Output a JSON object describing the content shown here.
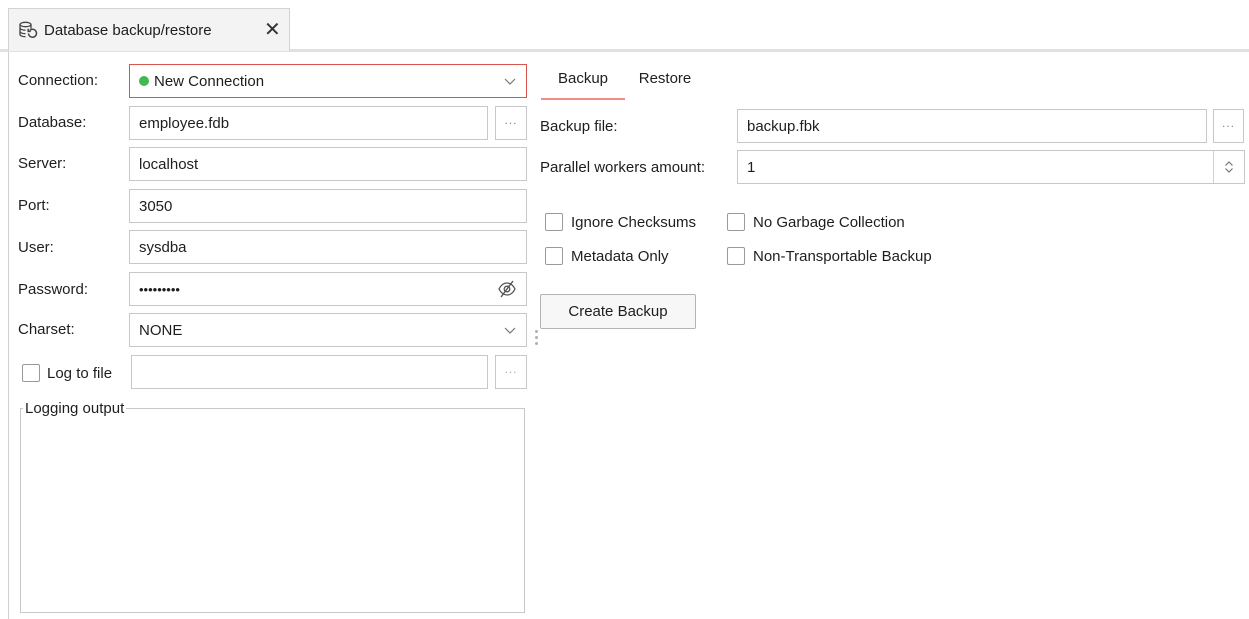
{
  "tab": {
    "title": "Database backup/restore",
    "icon": "database-sync-icon",
    "close_icon": "close-icon"
  },
  "connection": {
    "connection_label": "Connection:",
    "connection_value": "New Connection",
    "connection_status_color": "#3fb950",
    "database_label": "Database:",
    "database_value": "employee.fdb",
    "server_label": "Server:",
    "server_value": "localhost",
    "port_label": "Port:",
    "port_value": "3050",
    "user_label": "User:",
    "user_value": "sysdba",
    "password_label": "Password:",
    "password_value": "•••••••••",
    "charset_label": "Charset:",
    "charset_value": "NONE",
    "log_to_file_label": "Log to file",
    "log_to_file_checked": false,
    "log_file_value": "",
    "browse_label": "...",
    "logging_output_label": "Logging output"
  },
  "tabs": [
    {
      "label": "Backup",
      "active": true
    },
    {
      "label": "Restore",
      "active": false
    }
  ],
  "backup": {
    "backup_file_label": "Backup file:",
    "backup_file_value": "backup.fbk",
    "parallel_label": "Parallel workers amount:",
    "parallel_value": "1",
    "options": [
      {
        "label": "Ignore Checksums",
        "checked": false
      },
      {
        "label": "No Garbage Collection",
        "checked": false
      },
      {
        "label": "Metadata Only",
        "checked": false
      },
      {
        "label": "Non-Transportable Backup",
        "checked": false
      }
    ],
    "create_button": "Create Backup"
  },
  "colors": {
    "focus_border": "#d9544f",
    "active_tab_underline": "#f08d88"
  }
}
